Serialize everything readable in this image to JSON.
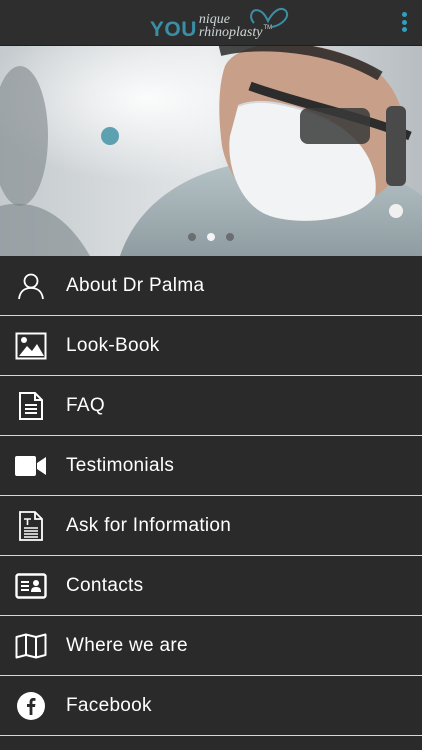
{
  "header": {
    "logo_you": "YOU",
    "logo_line1": "nique",
    "logo_line2": "rhinoplasty",
    "logo_tm": "TM",
    "menu_icon": "more-vertical-icon",
    "accent": "#2fa0c0",
    "logo_color": "#3a8ea6"
  },
  "carousel": {
    "slides": 3,
    "active_index": 1
  },
  "menu": {
    "items": [
      {
        "label": "About Dr Palma",
        "icon": "person-icon"
      },
      {
        "label": "Look-Book",
        "icon": "image-icon"
      },
      {
        "label": "FAQ",
        "icon": "document-icon"
      },
      {
        "label": "Testimonials",
        "icon": "video-camera-icon"
      },
      {
        "label": "Ask for Information",
        "icon": "form-icon"
      },
      {
        "label": "Contacts",
        "icon": "contact-card-icon"
      },
      {
        "label": "Where we are",
        "icon": "map-icon"
      },
      {
        "label": "Facebook",
        "icon": "facebook-icon"
      }
    ]
  }
}
